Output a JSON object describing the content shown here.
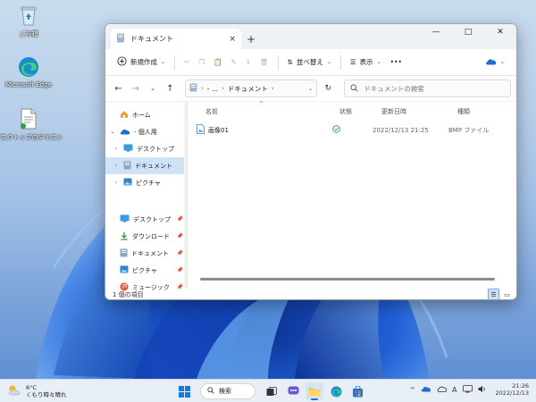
{
  "desktop": {
    "icons": [
      {
        "label": "ごみ箱",
        "icon": "recycle-bin-icon"
      },
      {
        "label": "Microsoft Edge",
        "icon": "edge-icon"
      },
      {
        "label": "デスクトップのテキスト",
        "icon": "text-document-icon"
      }
    ]
  },
  "window": {
    "tab_title": "ドキュメント",
    "tab_close": "×",
    "new_tab": "+",
    "controls": {
      "minimize": "—",
      "maximize": "□",
      "close": "✕"
    },
    "toolbar": {
      "new_label": "新規作成",
      "sort_label": "並べ替え",
      "view_label": "表示",
      "more_label": "•••"
    },
    "address": {
      "segments": [
        "›",
        "- ...",
        "›",
        "ドキュメント",
        "›"
      ],
      "dropdown": "⌄",
      "refresh": "↻"
    },
    "search": {
      "placeholder": "ドキュメントの検索"
    },
    "nav_pane": {
      "items": [
        {
          "label": "ホーム",
          "icon": "home-icon",
          "expander": ""
        },
        {
          "label": "- 個人用",
          "icon": "onedrive-icon",
          "expander": "⌄"
        },
        {
          "label": "デスクトップ",
          "icon": "desktop-folder-icon",
          "expander": "›"
        },
        {
          "label": "ドキュメント",
          "icon": "documents-folder-icon",
          "expander": "›"
        },
        {
          "label": "ピクチャ",
          "icon": "pictures-folder-icon",
          "expander": "›"
        }
      ],
      "quick_access": [
        {
          "label": "デスクトップ",
          "icon": "desktop-folder-icon"
        },
        {
          "label": "ダウンロード",
          "icon": "download-icon"
        },
        {
          "label": "ドキュメント",
          "icon": "documents-folder-icon"
        },
        {
          "label": "ピクチャ",
          "icon": "pictures-folder-icon"
        },
        {
          "label": "ミュージック",
          "icon": "music-icon"
        }
      ]
    },
    "columns": {
      "name": "名前",
      "status": "状態",
      "modified": "更新日時",
      "type": "種類"
    },
    "files": [
      {
        "name": "画像01",
        "status_icon": "synced-check-icon",
        "modified": "2022/12/13 21:25",
        "type": "BMP ファイル"
      }
    ],
    "status": {
      "count": "1 個の項目"
    }
  },
  "taskbar": {
    "weather": {
      "temp": "6°C",
      "condition": "くもり時々晴れ"
    },
    "search_label": "検索",
    "clock": {
      "time": "21:26",
      "date": "2022/12/13"
    },
    "ime": "A"
  },
  "colors": {
    "accent": "#1e6fd0",
    "selection": "#cfe3f7"
  }
}
